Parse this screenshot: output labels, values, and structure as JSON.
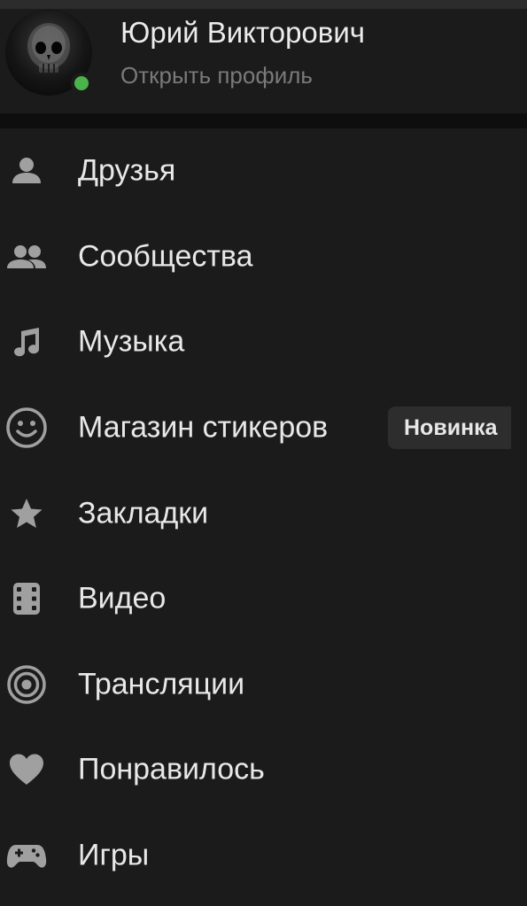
{
  "profile": {
    "name": "Юрий Викторович",
    "link": "Открыть профиль",
    "online_color": "#4bb34b"
  },
  "menu": {
    "items": [
      {
        "label": "Друзья",
        "icon": "person-icon"
      },
      {
        "label": "Сообщества",
        "icon": "people-icon"
      },
      {
        "label": "Музыка",
        "icon": "music-note-icon"
      },
      {
        "label": "Магазин стикеров",
        "icon": "smiley-icon",
        "badge": "Новинка"
      },
      {
        "label": "Закладки",
        "icon": "star-icon"
      },
      {
        "label": "Видео",
        "icon": "video-icon"
      },
      {
        "label": "Трансляции",
        "icon": "broadcast-icon"
      },
      {
        "label": "Понравилось",
        "icon": "heart-icon"
      },
      {
        "label": "Игры",
        "icon": "gamepad-icon"
      }
    ]
  },
  "colors": {
    "background": "#1b1b1b",
    "icon": "#a0a0a0",
    "text": "#e8e8e8",
    "secondary_text": "#7a7a7a"
  }
}
